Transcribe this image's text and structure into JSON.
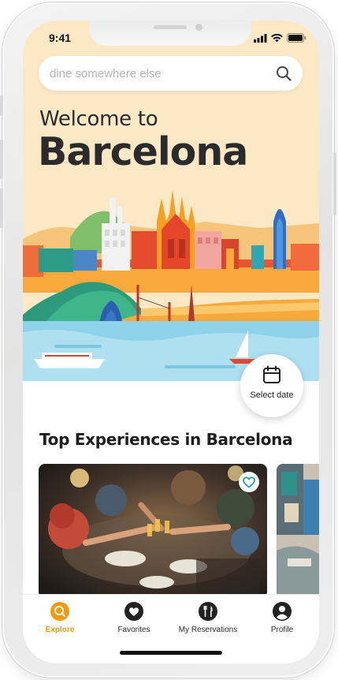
{
  "status_bar": {
    "time": "9:41"
  },
  "search": {
    "placeholder": "dine somewhere else"
  },
  "hero": {
    "welcome": "Welcome to",
    "city": "Barcelona",
    "date_button_label": "Select date"
  },
  "experiences": {
    "title": "Top Experiences in Barcelona",
    "cards": [
      {
        "favorite": true
      },
      {
        "favorite": false
      }
    ]
  },
  "tabbar": {
    "active": "Explore",
    "active_color": "#f29a0e",
    "items": [
      {
        "label": "Explore",
        "icon": "explore-icon"
      },
      {
        "label": "Favorites",
        "icon": "heart-icon"
      },
      {
        "label": "My Reservations",
        "icon": "cutlery-icon"
      },
      {
        "label": "Profile",
        "icon": "profile-icon"
      }
    ]
  },
  "colors": {
    "hero_bg": "#fde8c6",
    "accent": "#f29a0e",
    "favorite_teal": "#1fa5a8"
  }
}
